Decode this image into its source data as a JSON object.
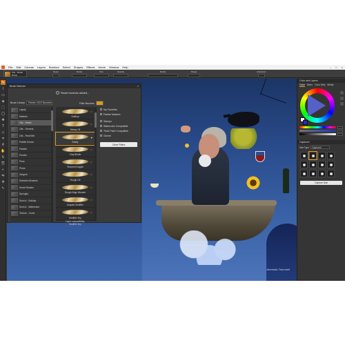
{
  "menubar": {
    "items": [
      "File",
      "Edit",
      "Canvas",
      "Layers",
      "Brushes",
      "Select",
      "Shapes",
      "Effects",
      "Movie",
      "Window",
      "Help"
    ]
  },
  "property_bar": {
    "brush_category": "Oils - Bristle",
    "brush_variant": "Bristly",
    "groups": [
      {
        "label": "Reset",
        "value": ""
      },
      {
        "label": "Stroke",
        "value": ""
      },
      {
        "label": "Size",
        "value": ""
      },
      {
        "label": "Opacity",
        "value": ""
      },
      {
        "label": "Media",
        "value": ""
      },
      {
        "label": "Shape",
        "value": ""
      },
      {
        "label": "Advanced",
        "value": ""
      }
    ]
  },
  "brush_selector": {
    "title": "Brush Selector",
    "reset_link": "Reset brushes added...",
    "library_label": "Brush Library",
    "library_value": "Painter 2022 Brushes",
    "filter_label": "Filter Brushes",
    "categories": [
      "Liquify",
      "Markers",
      "Oils - Bristle",
      "Oils - General",
      "Oils - Real Wet",
      "Palette Knives",
      "Pastels",
      "Pencils",
      "Pens",
      "Photo",
      "Sargent",
      "Selection Brushes",
      "Smart Strokes",
      "Sponges",
      "Sumi-e - Buildup",
      "Sumi-e - Watercolor",
      "Texture - Cover"
    ],
    "selected_category": "Oils - Bristle",
    "variants": [
      "Softboy",
      "Messy Oil",
      "Bristly",
      "Clay Bristle",
      "Textured Dapple",
      "Rough Oil",
      "Rough Edge Blender",
      "Angular Modifier",
      "Modifier Dry"
    ],
    "selected_variant": "Bristly",
    "filters": {
      "my_favorites": "My Favorites",
      "painter_masters": "Painter Masters",
      "stamps": "Stamps",
      "watercolor_compatible": "Watercolor Compatible",
      "thick_paint_compatible": "Thick Paint Compatible",
      "clones": "Clones"
    },
    "clear_filters": "Clear Filters",
    "footer_line1": "Layer compatibility:",
    "footer_line2": "Modifier Dry"
  },
  "color_panel": {
    "title": "Color and Layers",
    "tabs": [
      "Color",
      "Mixer",
      "Color Sets",
      "Media"
    ],
    "primary_color": "#ffffff",
    "secondary_color": "#2230c0"
  },
  "dab_panel": {
    "title": "Captured",
    "dab_label": "Dab Type",
    "dab_value": "Captured",
    "new_button": "Capture Dab"
  },
  "canvas": {
    "signature": "Jeremiah Trammell"
  },
  "colors": {
    "accent": "#e39c2a",
    "panel_bg": "#3b3b3b",
    "sky_top": "#1c3566",
    "sky_bottom": "#4d74b8"
  },
  "icons": {
    "tools": [
      "brush-icon",
      "eyedropper-icon",
      "eraser-icon",
      "fill-icon",
      "selection-icon",
      "lasso-icon",
      "transform-icon",
      "text-icon",
      "shape-icon",
      "crop-icon",
      "magnifier-icon",
      "hand-icon",
      "rotate-icon",
      "clone-icon",
      "divine-proportion-icon",
      "mirror-icon",
      "kaleidoscope-icon",
      "layer-adjuster-icon"
    ]
  }
}
